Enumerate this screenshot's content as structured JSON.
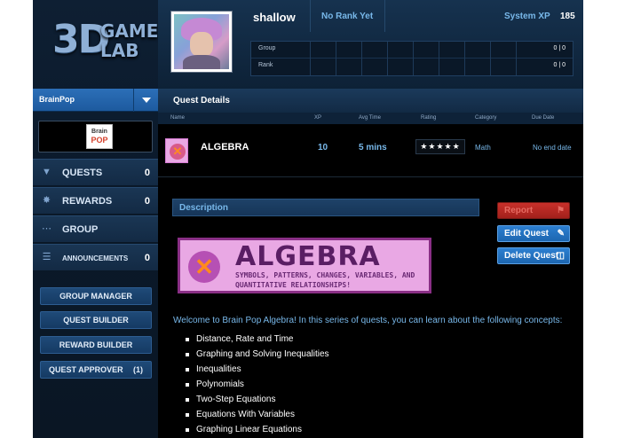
{
  "app": {
    "logo_big": "3D",
    "logo_line1": "GAME",
    "logo_line2": "LAB"
  },
  "sidebar": {
    "org_selector": "BrainPop",
    "org_logo_line1": "Brain",
    "org_logo_line2": "POP",
    "nav": [
      {
        "label": "QUESTS",
        "count": "0"
      },
      {
        "label": "REWARDS",
        "count": "0"
      },
      {
        "label": "GROUP",
        "count": ""
      },
      {
        "label": "ANNOUNCEMENTS",
        "count": "0"
      }
    ],
    "buttons": {
      "group_manager": "GROUP MANAGER",
      "quest_builder": "QUEST BUILDER",
      "reward_builder": "REWARD BUILDER",
      "quest_approver": "QUEST APPROVER",
      "quest_approver_count": "(1)"
    }
  },
  "header": {
    "username": "shallow",
    "rank": "No Rank Yet",
    "xp_label": "System XP",
    "xp_value": "185",
    "stats": [
      {
        "label": "Group",
        "value": "0 | 0"
      },
      {
        "label": "Rank",
        "value": "0 | 0"
      }
    ]
  },
  "quest_details": {
    "title": "Quest Details",
    "columns": [
      "Name",
      "XP",
      "Avg Time",
      "Rating",
      "Category",
      "Due Date"
    ],
    "quest": {
      "name": "ALGEBRA",
      "xp": "10",
      "avg_time": "5 mins",
      "rating": "★★★★★",
      "category": "Math",
      "due_date": "No end date"
    }
  },
  "description": {
    "heading": "Description",
    "banner_title": "ALGEBRA",
    "banner_subtitle": "SYMBOLS, PATTERNS, CHANGES, VARIABLES, AND QUANTITATIVE RELATIONSHIPS!",
    "intro": "Welcome to Brain Pop Algebra! In this series of quests, you can learn about the following concepts:",
    "concepts": [
      "Distance, Rate and Time",
      "Graphing and Solving Inequalities",
      "Inequalities",
      "Polynomials",
      "Two-Step Equations",
      "Equations With Variables",
      "Graphing Linear Equations"
    ]
  },
  "actions": {
    "report": "Report",
    "edit": "Edit Quest",
    "delete": "Delete Quest"
  },
  "colors": {
    "accent_blue": "#78b8ea",
    "report_red": "#c7302a",
    "quest_pink": "#e9a8e4"
  }
}
